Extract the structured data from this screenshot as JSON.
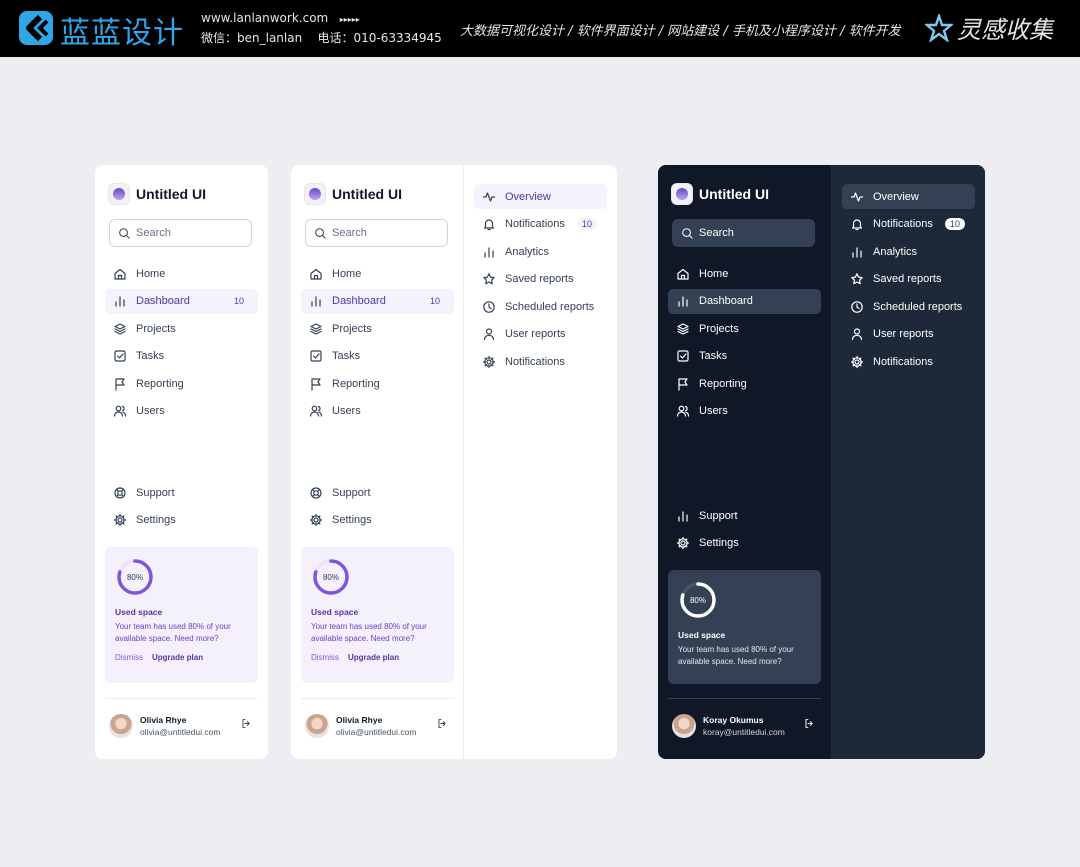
{
  "banner": {
    "brand": "蓝蓝设计",
    "website": "www.lanlanwork.com",
    "arrows": "▸▸▸▸▸",
    "wechat": "微信：ben_lanlan",
    "phone": "电话：010-63334945",
    "services": "大数据可视化设计  /  软件界面设计  /  网站建设  /  手机及小程序设计  /  软件开发",
    "collect": "灵感收集"
  },
  "app_name": "Untitled UI",
  "search_placeholder": "Search",
  "nav": [
    {
      "label": "Home",
      "icon": "home-icon"
    },
    {
      "label": "Dashboard",
      "icon": "bar-chart-icon",
      "badge": "10"
    },
    {
      "label": "Projects",
      "icon": "layers-icon"
    },
    {
      "label": "Tasks",
      "icon": "check-square-icon"
    },
    {
      "label": "Reporting",
      "icon": "flag-icon"
    },
    {
      "label": "Users",
      "icon": "users-icon"
    }
  ],
  "footer_nav": [
    {
      "label": "Support",
      "icon": "life-buoy-icon"
    },
    {
      "label": "Settings",
      "icon": "settings-icon"
    }
  ],
  "dark_footer_nav": [
    {
      "label": "Support",
      "icon": "bar-chart-icon"
    },
    {
      "label": "Settings",
      "icon": "settings-icon"
    }
  ],
  "usage": {
    "percent_label": "80%",
    "fraction": 0.8,
    "title": "Used space",
    "text": "Your team has used 80% of your available space. Need more?",
    "dismiss": "Dismiss",
    "upgrade": "Upgrade plan"
  },
  "user_light": {
    "name": "Olivia Rhye",
    "email": "olivia@untitledui.com"
  },
  "user_dark": {
    "name": "Koray Okumus",
    "email": "koray@untitledui.com"
  },
  "sub_nav": [
    {
      "label": "Overview",
      "icon": "activity-icon"
    },
    {
      "label": "Notifications",
      "icon": "bell-icon",
      "badge": "10"
    },
    {
      "label": "Analytics",
      "icon": "bar-chart-icon"
    },
    {
      "label": "Saved reports",
      "icon": "star-icon"
    },
    {
      "label": "Scheduled reports",
      "icon": "clock-icon"
    },
    {
      "label": "User reports",
      "icon": "user-icon"
    },
    {
      "label": "Notifications",
      "icon": "settings-icon"
    }
  ],
  "colors": {
    "accent": "#7f56d9",
    "dark_bg": "#101828",
    "dark_sub": "#1d2939",
    "banner_blue": "#2fa6e8"
  }
}
